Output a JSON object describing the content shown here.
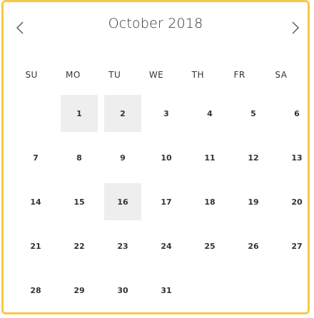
{
  "header": {
    "title": "October 2018",
    "prev_icon": "chevron-left-icon",
    "next_icon": "chevron-right-icon"
  },
  "weekdays": [
    "SU",
    "MO",
    "TU",
    "WE",
    "TH",
    "FR",
    "SA"
  ],
  "colors": {
    "border": "#f7c948",
    "highlight": "#eeeeee",
    "text": "#333333"
  },
  "leading_empty_days": 1,
  "days": [
    {
      "label": "1",
      "highlighted": true
    },
    {
      "label": "2",
      "highlighted": true
    },
    {
      "label": "3",
      "highlighted": false
    },
    {
      "label": "4",
      "highlighted": false
    },
    {
      "label": "5",
      "highlighted": false
    },
    {
      "label": "6",
      "highlighted": false
    },
    {
      "label": "7",
      "highlighted": false
    },
    {
      "label": "8",
      "highlighted": false
    },
    {
      "label": "9",
      "highlighted": false
    },
    {
      "label": "10",
      "highlighted": false
    },
    {
      "label": "11",
      "highlighted": false
    },
    {
      "label": "12",
      "highlighted": false
    },
    {
      "label": "13",
      "highlighted": false
    },
    {
      "label": "14",
      "highlighted": false
    },
    {
      "label": "15",
      "highlighted": false
    },
    {
      "label": "16",
      "highlighted": true
    },
    {
      "label": "17",
      "highlighted": false
    },
    {
      "label": "18",
      "highlighted": false
    },
    {
      "label": "19",
      "highlighted": false
    },
    {
      "label": "20",
      "highlighted": false
    },
    {
      "label": "21",
      "highlighted": false
    },
    {
      "label": "22",
      "highlighted": false
    },
    {
      "label": "23",
      "highlighted": false
    },
    {
      "label": "24",
      "highlighted": false
    },
    {
      "label": "25",
      "highlighted": false
    },
    {
      "label": "26",
      "highlighted": false
    },
    {
      "label": "27",
      "highlighted": false
    },
    {
      "label": "28",
      "highlighted": false
    },
    {
      "label": "29",
      "highlighted": false
    },
    {
      "label": "30",
      "highlighted": false
    },
    {
      "label": "31",
      "highlighted": false
    }
  ]
}
